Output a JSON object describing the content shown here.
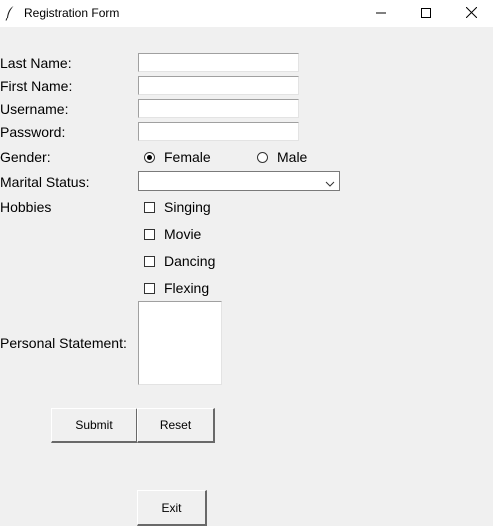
{
  "window": {
    "title": "Registration Form",
    "icon": "feather-icon",
    "controls": {
      "minimize_icon": "minimize-icon",
      "maximize_icon": "maximize-icon",
      "close_icon": "close-icon"
    }
  },
  "form": {
    "last_name": {
      "label": "Last Name:",
      "value": ""
    },
    "first_name": {
      "label": "First Name:",
      "value": ""
    },
    "username": {
      "label": "Username:",
      "value": ""
    },
    "password": {
      "label": "Password:",
      "value": ""
    },
    "gender": {
      "label": "Gender:",
      "options": [
        {
          "label": "Female",
          "selected": true
        },
        {
          "label": "Male",
          "selected": false
        }
      ]
    },
    "marital_status": {
      "label": "Marital Status:",
      "value": ""
    },
    "hobbies": {
      "label": "Hobbies",
      "options": [
        {
          "label": "Singing",
          "checked": false
        },
        {
          "label": "Movie",
          "checked": false
        },
        {
          "label": "Dancing",
          "checked": false
        },
        {
          "label": "Flexing",
          "checked": false
        }
      ]
    },
    "personal_statement": {
      "label": "Personal Statement:",
      "value": ""
    }
  },
  "buttons": {
    "submit": "Submit",
    "reset": "Reset",
    "exit": "Exit"
  },
  "colors": {
    "window_bg": "#f0f0f0",
    "titlebar_bg": "#ffffff"
  }
}
